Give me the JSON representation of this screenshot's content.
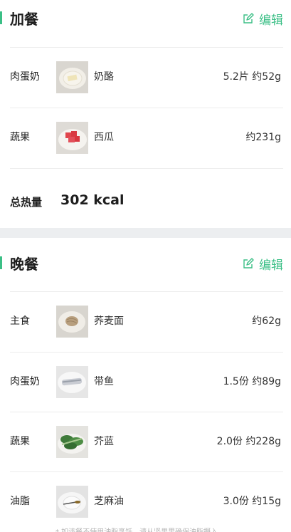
{
  "snack": {
    "title": "加餐",
    "edit_label": "编辑",
    "items": [
      {
        "category": "肉蛋奶",
        "name": "奶酪",
        "amount": "5.2片 约52g",
        "image": "cheese-on-plate"
      },
      {
        "category": "蔬果",
        "name": "西瓜",
        "amount": "约231g",
        "image": "watermelon-on-plate"
      }
    ],
    "total_label": "总热量",
    "total_value": "302 kcal"
  },
  "dinner": {
    "title": "晚餐",
    "edit_label": "编辑",
    "items": [
      {
        "category": "主食",
        "name": "荞麦面",
        "amount": "约62g",
        "image": "buckwheat-noodles-on-plate"
      },
      {
        "category": "肉蛋奶",
        "name": "带鱼",
        "amount": "1.5份 约89g",
        "image": "hairtail-fish-on-plate"
      },
      {
        "category": "蔬果",
        "name": "芥蓝",
        "amount": "2.0份 约228g",
        "image": "chinese-kale-on-plate"
      },
      {
        "category": "油脂",
        "name": "芝麻油",
        "amount": "3.0份 约15g",
        "image": "sesame-oil-on-plate"
      }
    ]
  },
  "footer_note": "* 如该餐不使用油脂烹饪，请从坚果里确保油脂摄入",
  "colors": {
    "accent": "#3bbf86",
    "divider": "#ececec",
    "gap": "#eceef0"
  }
}
